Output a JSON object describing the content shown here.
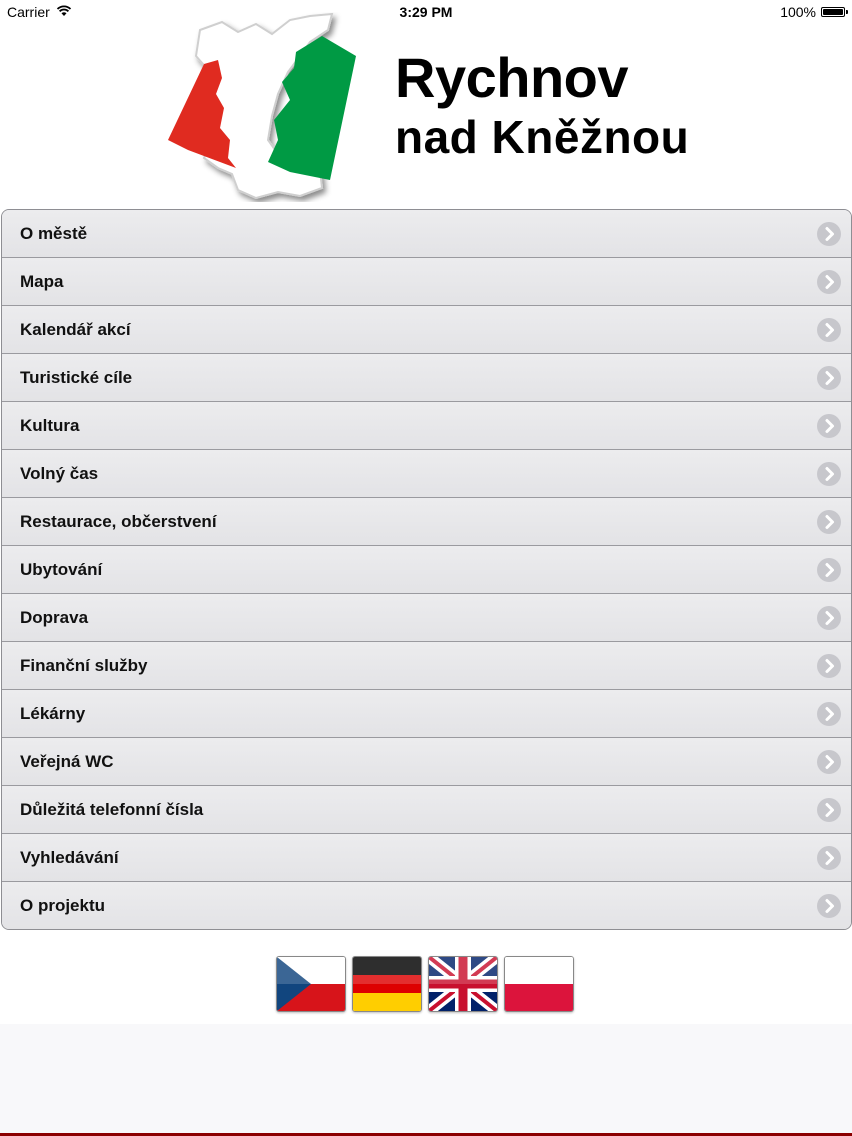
{
  "status_bar": {
    "carrier": "Carrier",
    "time": "3:29 PM",
    "battery": "100%"
  },
  "logo": {
    "title": "Rychnov",
    "subtitle": "nad Kněžnou",
    "colors": {
      "red": "#e02b20",
      "green": "#009a44"
    }
  },
  "menu": {
    "items": [
      {
        "label": "O městě"
      },
      {
        "label": "Mapa"
      },
      {
        "label": "Kalendář akcí"
      },
      {
        "label": "Turistické cíle"
      },
      {
        "label": "Kultura"
      },
      {
        "label": "Volný čas"
      },
      {
        "label": "Restaurace, občerstvení"
      },
      {
        "label": "Ubytování"
      },
      {
        "label": "Doprava"
      },
      {
        "label": "Finanční služby"
      },
      {
        "label": "Lékárny"
      },
      {
        "label": "Veřejná WC"
      },
      {
        "label": "Důležitá telefonní čísla"
      },
      {
        "label": "Vyhledávání"
      },
      {
        "label": "O projektu"
      }
    ],
    "chevron_icon": "chevron-right-icon"
  },
  "languages": [
    {
      "flag": "czech-flag-icon"
    },
    {
      "flag": "german-flag-icon"
    },
    {
      "flag": "uk-flag-icon"
    },
    {
      "flag": "polish-flag-icon"
    }
  ]
}
